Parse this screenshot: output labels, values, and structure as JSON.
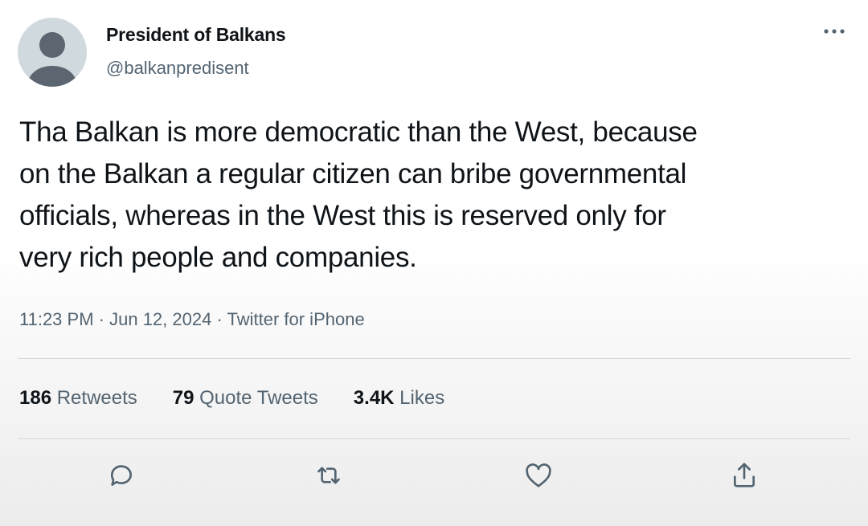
{
  "author": {
    "display_name": "President of Balkans",
    "handle": "@balkanpredisent"
  },
  "tweet": {
    "lines": [
      "Tha Balkan is more democratic than the West, because",
      "on the Balkan a regular citizen can bribe governmental",
      "officials, whereas in the West this is reserved only for",
      "very rich people and companies."
    ],
    "time": "11:23 PM",
    "date": "Jun 12, 2024",
    "source": "Twitter for iPhone",
    "separator": " · "
  },
  "stats": {
    "retweets_count": "186",
    "retweets_label": "Retweets",
    "quotes_count": "79",
    "quotes_label": "Quote Tweets",
    "likes_count": "3.4K",
    "likes_label": "Likes"
  },
  "icons": {
    "more": "more-dots-icon",
    "reply": "reply-icon",
    "retweet": "retweet-icon",
    "like": "heart-icon",
    "share": "share-icon"
  },
  "colors": {
    "text_primary": "#0f1419",
    "text_secondary": "#536471",
    "icon": "#536471",
    "divider": "#cfd9de",
    "avatar_bg": "#cfd9de",
    "avatar_fg": "#5b6670"
  }
}
